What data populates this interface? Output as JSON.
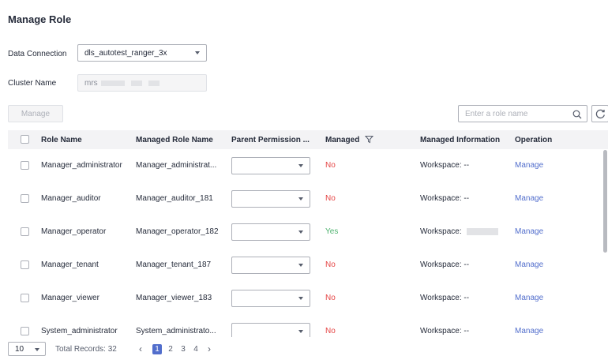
{
  "page": {
    "title": "Manage Role"
  },
  "form": {
    "data_connection_label": "Data Connection",
    "data_connection_value": "dls_autotest_ranger_3x",
    "cluster_name_label": "Cluster Name",
    "cluster_name_value": "mrs"
  },
  "toolbar": {
    "manage_label": "Manage",
    "search_placeholder": "Enter a role name"
  },
  "table": {
    "headers": {
      "role_name": "Role Name",
      "managed_role_name": "Managed Role Name",
      "parent_permission": "Parent Permission ...",
      "managed": "Managed",
      "managed_information": "Managed Information",
      "operation": "Operation"
    },
    "rows": [
      {
        "role_name": "Manager_administrator",
        "managed_role_name": "Manager_administrat...",
        "parent_permission": "",
        "managed": "No",
        "managed_information": "Workspace: --",
        "operation": "Manage"
      },
      {
        "role_name": "Manager_auditor",
        "managed_role_name": "Manager_auditor_181",
        "parent_permission": "",
        "managed": "No",
        "managed_information": "Workspace: --",
        "operation": "Manage"
      },
      {
        "role_name": "Manager_operator",
        "managed_role_name": "Manager_operator_182",
        "parent_permission": "",
        "managed": "Yes",
        "managed_information": "Workspace:",
        "operation": "Manage"
      },
      {
        "role_name": "Manager_tenant",
        "managed_role_name": "Manager_tenant_187",
        "parent_permission": "",
        "managed": "No",
        "managed_information": "Workspace: --",
        "operation": "Manage"
      },
      {
        "role_name": "Manager_viewer",
        "managed_role_name": "Manager_viewer_183",
        "parent_permission": "",
        "managed": "No",
        "managed_information": "Workspace: --",
        "operation": "Manage"
      },
      {
        "role_name": "System_administrator",
        "managed_role_name": "System_administrato...",
        "parent_permission": "",
        "managed": "No",
        "managed_information": "Workspace: --",
        "operation": "Manage"
      }
    ]
  },
  "pagination": {
    "page_size": "10",
    "total": "Total Records: 32",
    "prev": "‹",
    "pages": [
      "1",
      "2",
      "3",
      "4"
    ],
    "current": "1",
    "next": "›"
  },
  "colors": {
    "link": "#526ecc",
    "no": "#e54545",
    "yes": "#50b370",
    "accent": "#526ecc"
  },
  "icons": [
    "search-icon",
    "refresh-icon",
    "filter-icon",
    "chevron-down-icon",
    "chevron-left-icon",
    "chevron-right-icon"
  ]
}
